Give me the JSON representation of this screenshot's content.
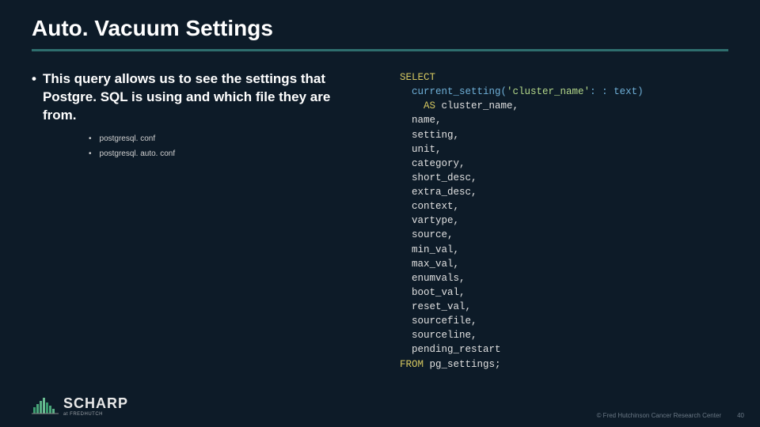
{
  "title": "Auto. Vacuum Settings",
  "bullet_text": "This query allows us to see the settings that Postgre. SQL is using and which file they are from.",
  "sub_items": [
    "postgresql. conf",
    "postgresql. auto. conf"
  ],
  "code": {
    "select": "SELECT",
    "fn_open": "current_setting(",
    "str": "'cluster_name'",
    "cast": ": : text)",
    "as": "AS",
    "alias": " cluster_name,",
    "cols": [
      "name,",
      "setting,",
      "unit,",
      "category,",
      "short_desc,",
      "extra_desc,",
      "context,",
      "vartype,",
      "source,",
      "min_val,",
      "max_val,",
      "enumvals,",
      "boot_val,",
      "reset_val,",
      "sourcefile,",
      "sourceline,",
      "pending_restart"
    ],
    "from": "FROM",
    "table": " pg_settings;"
  },
  "logo": {
    "name": "SCHARP",
    "sub": "at FREDHUTCH"
  },
  "footer": {
    "copyright": "© Fred Hutchinson Cancer Research Center",
    "page": "40"
  }
}
